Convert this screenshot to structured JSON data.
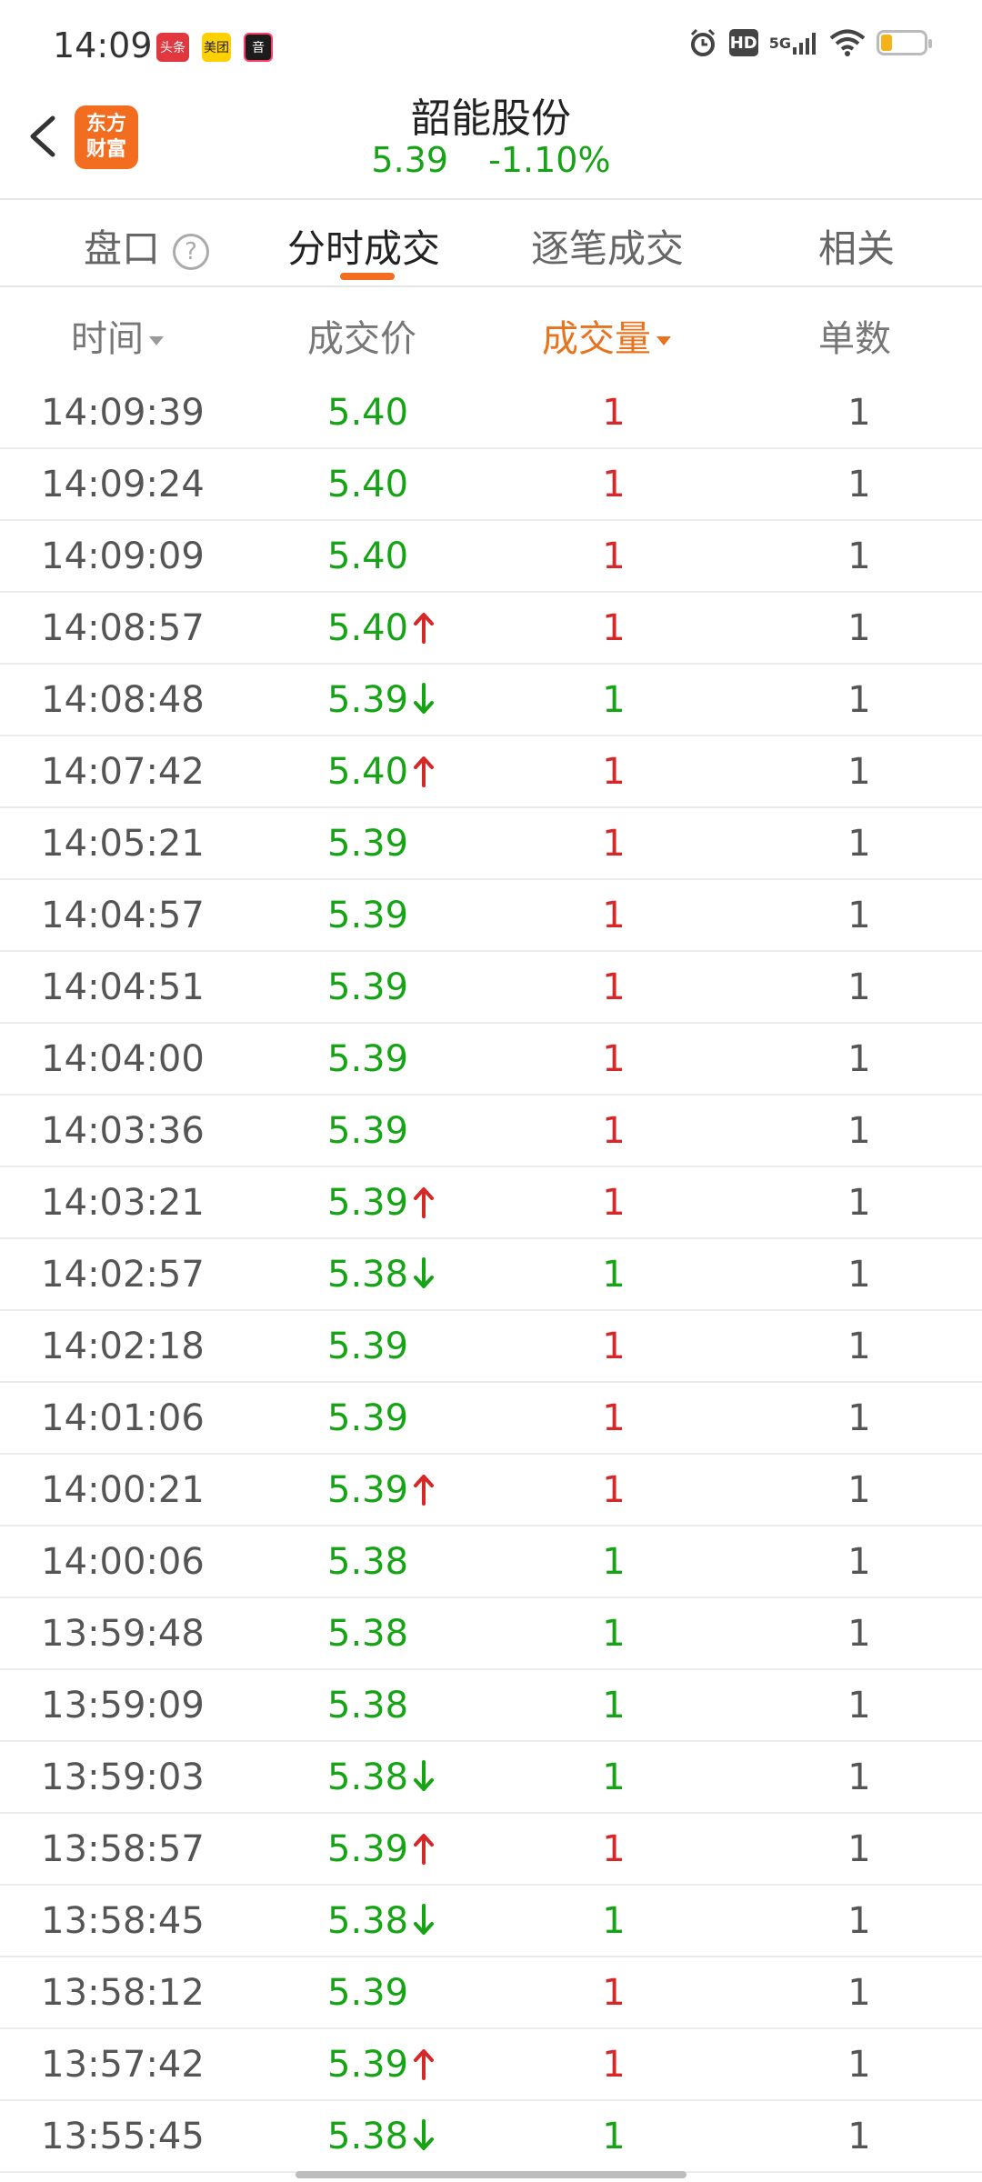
{
  "status_bar": {
    "time": "14:09",
    "apps": [
      "头条",
      "美团",
      "音"
    ],
    "icons": [
      "alarm-icon",
      "hd-icon",
      "5g-signal-icon",
      "wifi-icon",
      "battery-icon"
    ],
    "network": "5G",
    "hd_label": "HD",
    "battery_level": 0.25
  },
  "header": {
    "logo_line1": "东方",
    "logo_line2": "财富",
    "title": "韶能股份",
    "price": "5.39",
    "change_pct": "-1.10%",
    "price_color": "#16a316"
  },
  "tabs": {
    "pankou": "盘口",
    "help": "?",
    "fenshi": "分时成交",
    "zhubi": "逐笔成交",
    "xiangguan": "相关",
    "active": "fenshi",
    "accent": "#f26d1f"
  },
  "columns": {
    "time": "时间",
    "price": "成交价",
    "volume": "成交量",
    "count": "单数",
    "sorted_by": "volume"
  },
  "colors": {
    "up": "#d62828",
    "down": "#16a316"
  },
  "trades": [
    {
      "time": "14:09:39",
      "price": "5.40",
      "dir": "",
      "volume": "1",
      "vol_color": "red",
      "count": "1"
    },
    {
      "time": "14:09:24",
      "price": "5.40",
      "dir": "",
      "volume": "1",
      "vol_color": "red",
      "count": "1"
    },
    {
      "time": "14:09:09",
      "price": "5.40",
      "dir": "",
      "volume": "1",
      "vol_color": "red",
      "count": "1"
    },
    {
      "time": "14:08:57",
      "price": "5.40",
      "dir": "up",
      "volume": "1",
      "vol_color": "red",
      "count": "1"
    },
    {
      "time": "14:08:48",
      "price": "5.39",
      "dir": "down",
      "volume": "1",
      "vol_color": "green",
      "count": "1"
    },
    {
      "time": "14:07:42",
      "price": "5.40",
      "dir": "up",
      "volume": "1",
      "vol_color": "red",
      "count": "1"
    },
    {
      "time": "14:05:21",
      "price": "5.39",
      "dir": "",
      "volume": "1",
      "vol_color": "red",
      "count": "1"
    },
    {
      "time": "14:04:57",
      "price": "5.39",
      "dir": "",
      "volume": "1",
      "vol_color": "red",
      "count": "1"
    },
    {
      "time": "14:04:51",
      "price": "5.39",
      "dir": "",
      "volume": "1",
      "vol_color": "red",
      "count": "1"
    },
    {
      "time": "14:04:00",
      "price": "5.39",
      "dir": "",
      "volume": "1",
      "vol_color": "red",
      "count": "1"
    },
    {
      "time": "14:03:36",
      "price": "5.39",
      "dir": "",
      "volume": "1",
      "vol_color": "red",
      "count": "1"
    },
    {
      "time": "14:03:21",
      "price": "5.39",
      "dir": "up",
      "volume": "1",
      "vol_color": "red",
      "count": "1"
    },
    {
      "time": "14:02:57",
      "price": "5.38",
      "dir": "down",
      "volume": "1",
      "vol_color": "green",
      "count": "1"
    },
    {
      "time": "14:02:18",
      "price": "5.39",
      "dir": "",
      "volume": "1",
      "vol_color": "red",
      "count": "1"
    },
    {
      "time": "14:01:06",
      "price": "5.39",
      "dir": "",
      "volume": "1",
      "vol_color": "red",
      "count": "1"
    },
    {
      "time": "14:00:21",
      "price": "5.39",
      "dir": "up",
      "volume": "1",
      "vol_color": "red",
      "count": "1"
    },
    {
      "time": "14:00:06",
      "price": "5.38",
      "dir": "",
      "volume": "1",
      "vol_color": "green",
      "count": "1"
    },
    {
      "time": "13:59:48",
      "price": "5.38",
      "dir": "",
      "volume": "1",
      "vol_color": "green",
      "count": "1"
    },
    {
      "time": "13:59:09",
      "price": "5.38",
      "dir": "",
      "volume": "1",
      "vol_color": "green",
      "count": "1"
    },
    {
      "time": "13:59:03",
      "price": "5.38",
      "dir": "down",
      "volume": "1",
      "vol_color": "green",
      "count": "1"
    },
    {
      "time": "13:58:57",
      "price": "5.39",
      "dir": "up",
      "volume": "1",
      "vol_color": "red",
      "count": "1"
    },
    {
      "time": "13:58:45",
      "price": "5.38",
      "dir": "down",
      "volume": "1",
      "vol_color": "green",
      "count": "1"
    },
    {
      "time": "13:58:12",
      "price": "5.39",
      "dir": "",
      "volume": "1",
      "vol_color": "red",
      "count": "1"
    },
    {
      "time": "13:57:42",
      "price": "5.39",
      "dir": "up",
      "volume": "1",
      "vol_color": "red",
      "count": "1"
    },
    {
      "time": "13:55:45",
      "price": "5.38",
      "dir": "down",
      "volume": "1",
      "vol_color": "green",
      "count": "1"
    }
  ]
}
